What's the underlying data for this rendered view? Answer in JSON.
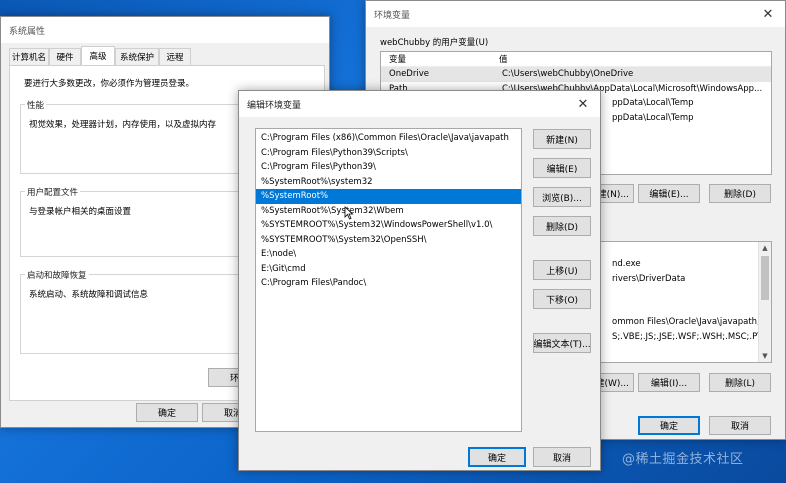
{
  "sys_props": {
    "title": "系统属性",
    "tabs": [
      "计算机名",
      "硬件",
      "高级",
      "系统保护",
      "远程"
    ],
    "admin_note": "要进行大多数更改，你必须作为管理员登录。",
    "performance": {
      "title": "性能",
      "desc": "视觉效果，处理器计划，内存使用，以及虚拟内存"
    },
    "profiles": {
      "title": "用户配置文件",
      "desc": "与登录帐户相关的桌面设置"
    },
    "startup": {
      "title": "启动和故障恢复",
      "desc": "系统启动、系统故障和调试信息"
    },
    "env_btn_partial": "环",
    "ok": "确定",
    "cancel": "取消"
  },
  "env_vars": {
    "title": "环境变量",
    "user_group_title": "webChubby 的用户变量(U)",
    "col_var": "变量",
    "col_val": "值",
    "user_rows": [
      {
        "name": "OneDrive",
        "value": "C:\\Users\\webChubby\\OneDrive"
      },
      {
        "name": "Path",
        "value": "C:\\Users\\webChubby\\AppData\\Local\\Microsoft\\WindowsApp..."
      },
      {
        "name": "",
        "value": "ppData\\Local\\Temp"
      },
      {
        "name": "",
        "value": "ppData\\Local\\Temp"
      }
    ],
    "user_btn_new": "建(N)...",
    "user_btn_edit": "编辑(E)...",
    "user_btn_delete": "删除(D)",
    "sys_rows": [
      "nd.exe",
      "rivers\\DriverData",
      "",
      "",
      "",
      "",
      "ommon Files\\Oracle\\Java\\javapath;C:...",
      "S;.VBE;.JS;.JSE;.WSF;.WSH;.MSC;.PY;.P..."
    ],
    "sys_btn_new": "建(W)...",
    "sys_btn_edit": "编辑(I)...",
    "sys_btn_delete": "删除(L)",
    "ok": "确定",
    "cancel": "取消"
  },
  "edit_env": {
    "title": "编辑环境变量",
    "items": [
      "C:\\Program Files (x86)\\Common Files\\Oracle\\Java\\javapath",
      "C:\\Program Files\\Python39\\Scripts\\",
      "C:\\Program Files\\Python39\\",
      "%SystemRoot%\\system32",
      "%SystemRoot%",
      "%SystemRoot%\\System32\\Wbem",
      "%SYSTEMROOT%\\System32\\WindowsPowerShell\\v1.0\\",
      "%SYSTEMROOT%\\System32\\OpenSSH\\",
      "E:\\node\\",
      "E:\\Git\\cmd",
      "C:\\Program Files\\Pandoc\\"
    ],
    "selected_index": 4,
    "btn_new": "新建(N)",
    "btn_edit": "编辑(E)",
    "btn_browse": "浏览(B)...",
    "btn_delete": "删除(D)",
    "btn_up": "上移(U)",
    "btn_down": "下移(O)",
    "btn_edit_text": "编辑文本(T)...",
    "ok": "确定",
    "cancel": "取消"
  },
  "watermark": "@稀土掘金技术社区"
}
